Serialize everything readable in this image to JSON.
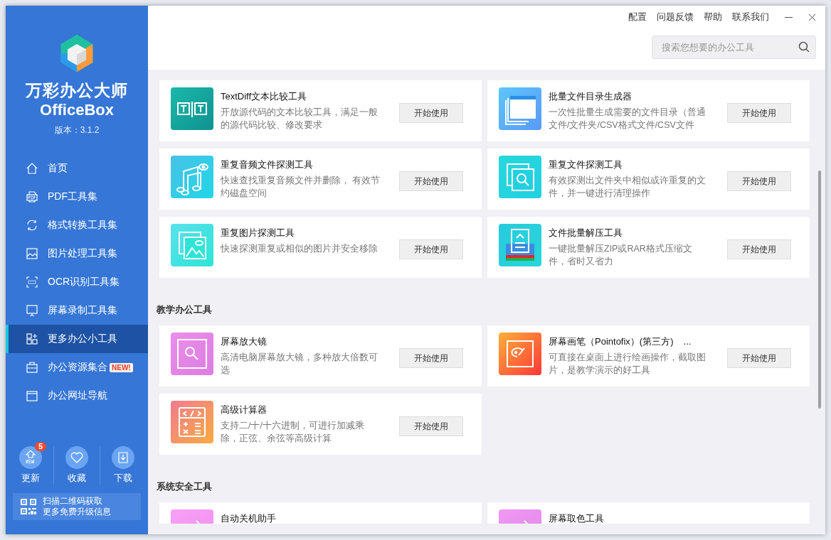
{
  "app": {
    "name": "万彩办公大师",
    "name_latin": "OfficeBox",
    "version": "版本：3.1.2"
  },
  "sidebar": {
    "items": [
      {
        "label": "首页",
        "selected": false
      },
      {
        "label": "PDF工具集",
        "selected": false
      },
      {
        "label": "格式转换工具集",
        "selected": false
      },
      {
        "label": "图片处理工具集",
        "selected": false
      },
      {
        "label": "OCR识别工具集",
        "selected": false
      },
      {
        "label": "屏幕录制工具集",
        "selected": false
      },
      {
        "label": "更多办公小工具",
        "selected": true
      },
      {
        "label": "办公资源集合",
        "selected": false,
        "badge": "NEW!"
      },
      {
        "label": "办公网址导航",
        "selected": false
      }
    ],
    "actions": [
      {
        "label": "更新",
        "badge": "5"
      },
      {
        "label": "收藏"
      },
      {
        "label": "下载"
      }
    ],
    "qr_text": [
      "扫描二维码获取",
      "更多免费升级信息"
    ]
  },
  "header": {
    "links": [
      "配置",
      "问题反馈",
      "帮助",
      "联系我们"
    ],
    "search": {
      "placeholder": "搜索您想要的办公工具"
    }
  },
  "sections": [
    {
      "cards": [
        {
          "title": "TextDiff文本比较工具",
          "description": "开放源代码的文本比较工具，满足一般的源代码比较、修改要求",
          "button": "开始使用"
        },
        {
          "title": "批量文件目录生成器",
          "description": "一次性批量生成需要的文件目录（普通文件/文件夹/CSV格式文件/CSV文件",
          "button": "开始使用"
        },
        {
          "title": "重复音频文件探测工具",
          "description": "快速查找重复音频文件并删除， 有效节约磁盘空间",
          "button": "开始使用"
        },
        {
          "title": "重复文件探测工具",
          "description": "有效探测出文件夹中相似或许重复的文件，并一键进行清理操作",
          "button": "开始使用"
        },
        {
          "title": "重复图片探测工具",
          "description": "快速探测重复或相似的图片并安全移除",
          "button": "开始使用"
        },
        {
          "title": "文件批量解压工具",
          "description": "一键批量解压ZIP或RAR格式压缩文件，省时又省力",
          "button": "开始使用"
        }
      ]
    },
    {
      "title": "教学办公工具",
      "cards": [
        {
          "title": "屏幕放大镜",
          "description": "高清电脑屏幕放大镜，多种放大倍数可选",
          "button": "开始使用"
        },
        {
          "title": "屏幕画笔（Pointofix）(第三方)",
          "ellipsis": "...",
          "description": "可直接在桌面上进行绘画操作，截取图片，是教学演示的好工具",
          "button": "开始使用"
        },
        {
          "title": "高级计算器",
          "description": "支持二/十/十六进制，可进行加减乘除，正弦、余弦等高级计算",
          "button": "开始使用"
        }
      ]
    },
    {
      "title": "系统安全工具",
      "cards": [
        {
          "title": "自动关机助手"
        },
        {
          "title": "屏幕取色工具"
        }
      ]
    }
  ]
}
